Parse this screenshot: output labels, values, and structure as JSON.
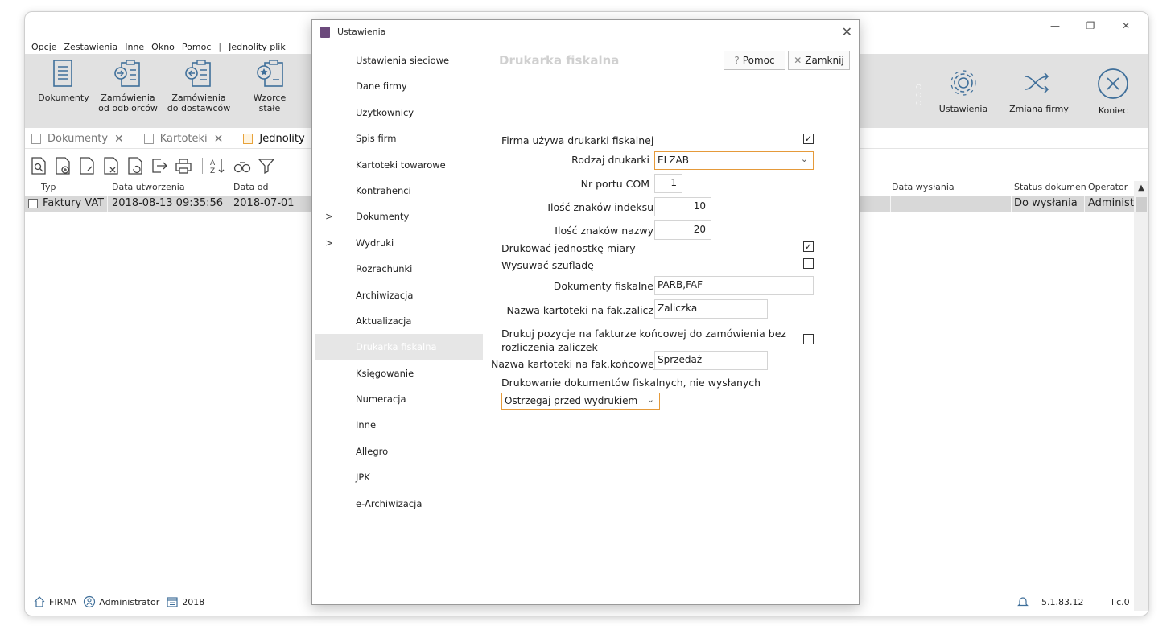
{
  "window": {
    "controls": {
      "minimize": "—",
      "maximize": "❐",
      "close": "✕"
    }
  },
  "menubar": {
    "items": [
      "Opcje",
      "Zestawienia",
      "Inne",
      "Okno",
      "Pomoc",
      "|",
      "Jednolity plik"
    ]
  },
  "ribbon": {
    "left_buttons": [
      {
        "label": "Dokumenty",
        "icon": "document-icon"
      },
      {
        "label": "Zamówienia\nod odbiorców",
        "icon": "order-in-icon"
      },
      {
        "label": "Zamówienia\ndo dostawców",
        "icon": "order-out-icon"
      },
      {
        "label": "Wzorce\nstałe",
        "icon": "template-icon"
      }
    ],
    "right_buttons": [
      {
        "label": "Ustawienia",
        "icon": "gear-icon"
      },
      {
        "label": "Zmiana firmy",
        "icon": "shuffle-icon"
      },
      {
        "label": "Koniec",
        "icon": "close-circle-icon"
      }
    ]
  },
  "tabs": [
    {
      "label": "Dokumenty",
      "close": "✕"
    },
    {
      "label": "Kartoteki",
      "close": "✕"
    },
    {
      "label": "Jednolity"
    }
  ],
  "grid": {
    "columns": [
      "Typ",
      "Data utworzenia",
      "Data od",
      "Data wysłania",
      "Status dokument",
      "Operator"
    ],
    "rows": [
      {
        "typ": "Faktury VAT",
        "data_utworzenia": "2018-08-13 09:35:56",
        "data_od": "2018-07-01",
        "data_wyslania": "",
        "status": "Do wysłania",
        "operator": "Administr"
      }
    ]
  },
  "statusbar": {
    "firm": "FIRMA",
    "user": "Administrator",
    "year": "2018",
    "version": "5.1.83.12",
    "license": "lic.0"
  },
  "dialog": {
    "title": "Ustawienia",
    "close": "✕",
    "nav": [
      {
        "label": "Ustawienia sieciowe"
      },
      {
        "label": "Dane firmy"
      },
      {
        "label": "Użytkownicy"
      },
      {
        "label": "Spis firm"
      },
      {
        "label": "Kartoteki towarowe"
      },
      {
        "label": "Kontrahenci"
      },
      {
        "label": "Dokumenty",
        "chevron": ">"
      },
      {
        "label": "Wydruki",
        "chevron": ">"
      },
      {
        "label": "Rozrachunki"
      },
      {
        "label": "Archiwizacja"
      },
      {
        "label": "Aktualizacja"
      },
      {
        "label": "Drukarka fiskalna",
        "selected": true
      },
      {
        "label": "Księgowanie"
      },
      {
        "label": "Numeracja"
      },
      {
        "label": "Inne"
      },
      {
        "label": "Allegro"
      },
      {
        "label": "JPK"
      },
      {
        "label": "e-Archiwizacja"
      }
    ],
    "section_title": "Drukarka fiskalna",
    "help_button": {
      "icon": "?",
      "label": "Pomoc"
    },
    "close_button": {
      "icon": "✕",
      "label": "Zamknij"
    },
    "form": {
      "uses_fiscal_printer": {
        "label": "Firma używa drukarki fiskalnej",
        "checked": true,
        "mark": "✓"
      },
      "printer_type": {
        "label": "Rodzaj drukarki",
        "value": "ELZAB",
        "arrow": "⌄"
      },
      "com_port": {
        "label": "Nr portu COM",
        "value": "1"
      },
      "index_chars": {
        "label": "Ilość znaków indeksu",
        "value": "10"
      },
      "name_chars": {
        "label": "Ilość znaków nazwy",
        "value": "20"
      },
      "print_unit": {
        "label": "Drukować jednostkę miary",
        "checked": true,
        "mark": "✓"
      },
      "open_drawer": {
        "label": "Wysuwać szufladę",
        "checked": false,
        "mark": ""
      },
      "fiscal_docs": {
        "label": "Dokumenty fiskalne",
        "value": "PARB,FAF"
      },
      "advance_card": {
        "label": "Nazwa kartoteki na fak.zalicz",
        "value": "Zaliczka"
      },
      "print_positions": {
        "label_line1": "Drukuj pozycje na fakturze końcowej do zamówienia bez",
        "label_line2": "rozliczenia zaliczek",
        "checked": false,
        "mark": ""
      },
      "final_card": {
        "label": "Nazwa kartoteki na fak.końcowej",
        "value": "Sprzedaż"
      },
      "unsent_printing": {
        "label": "Drukowanie dokumentów fiskalnych, nie wysłanych",
        "value": "Ostrzegaj przed wydrukiem",
        "arrow": "⌄"
      }
    }
  }
}
